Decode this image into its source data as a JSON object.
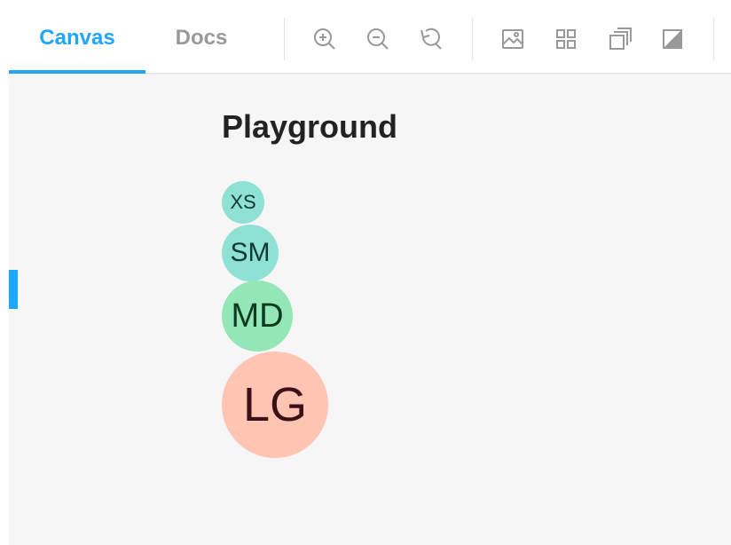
{
  "tabs": {
    "canvas": "Canvas",
    "docs": "Docs"
  },
  "toolbar_icons": [
    "zoom-in-icon",
    "zoom-out-icon",
    "reset-zoom-icon",
    "background-icon",
    "grid-icon",
    "viewport-icon",
    "theme-contrast-icon"
  ],
  "page": {
    "title": "Playground"
  },
  "avatars": [
    {
      "label": "XS",
      "color": "#8fe1d3"
    },
    {
      "label": "SM",
      "color": "#8fe1d3"
    },
    {
      "label": "MD",
      "color": "#93e6b5"
    },
    {
      "label": "LG",
      "color": "#ffc5b2"
    }
  ],
  "colors": {
    "accent": "#1ea7fd",
    "inactive": "#999999"
  }
}
